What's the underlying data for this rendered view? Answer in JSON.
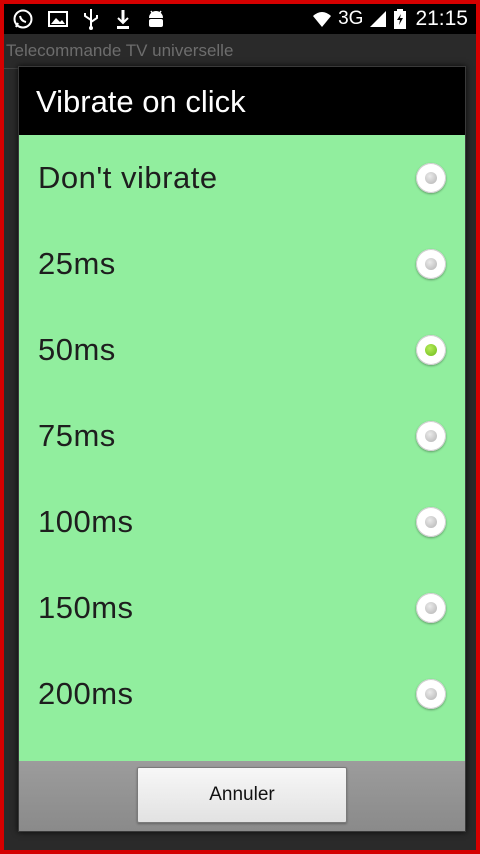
{
  "status_bar": {
    "icons_left": [
      "whatsapp-icon",
      "gallery-icon",
      "usb-icon",
      "download-icon",
      "android-debug-icon"
    ],
    "network_label": "3G",
    "time": "21:15"
  },
  "background_app": {
    "title": "Telecommande TV universelle"
  },
  "dialog": {
    "title": "Vibrate on click",
    "options": [
      {
        "label": "Don't vibrate",
        "checked": false
      },
      {
        "label": "25ms",
        "checked": false
      },
      {
        "label": "50ms",
        "checked": true
      },
      {
        "label": "75ms",
        "checked": false
      },
      {
        "label": "100ms",
        "checked": false
      },
      {
        "label": "150ms",
        "checked": false
      },
      {
        "label": "200ms",
        "checked": false
      }
    ],
    "cancel_label": "Annuler"
  },
  "colors": {
    "frame": "#d50000",
    "options_background": "#91ee9e",
    "checked_radio": "#7cc520"
  }
}
